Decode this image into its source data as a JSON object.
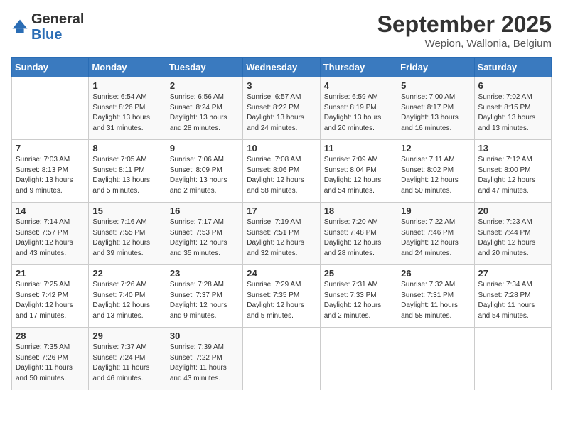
{
  "logo": {
    "general": "General",
    "blue": "Blue"
  },
  "title": "September 2025",
  "location": "Wepion, Wallonia, Belgium",
  "days_of_week": [
    "Sunday",
    "Monday",
    "Tuesday",
    "Wednesday",
    "Thursday",
    "Friday",
    "Saturday"
  ],
  "weeks": [
    [
      {
        "day": "",
        "info": ""
      },
      {
        "day": "1",
        "info": "Sunrise: 6:54 AM\nSunset: 8:26 PM\nDaylight: 13 hours\nand 31 minutes."
      },
      {
        "day": "2",
        "info": "Sunrise: 6:56 AM\nSunset: 8:24 PM\nDaylight: 13 hours\nand 28 minutes."
      },
      {
        "day": "3",
        "info": "Sunrise: 6:57 AM\nSunset: 8:22 PM\nDaylight: 13 hours\nand 24 minutes."
      },
      {
        "day": "4",
        "info": "Sunrise: 6:59 AM\nSunset: 8:19 PM\nDaylight: 13 hours\nand 20 minutes."
      },
      {
        "day": "5",
        "info": "Sunrise: 7:00 AM\nSunset: 8:17 PM\nDaylight: 13 hours\nand 16 minutes."
      },
      {
        "day": "6",
        "info": "Sunrise: 7:02 AM\nSunset: 8:15 PM\nDaylight: 13 hours\nand 13 minutes."
      }
    ],
    [
      {
        "day": "7",
        "info": "Sunrise: 7:03 AM\nSunset: 8:13 PM\nDaylight: 13 hours\nand 9 minutes."
      },
      {
        "day": "8",
        "info": "Sunrise: 7:05 AM\nSunset: 8:11 PM\nDaylight: 13 hours\nand 5 minutes."
      },
      {
        "day": "9",
        "info": "Sunrise: 7:06 AM\nSunset: 8:09 PM\nDaylight: 13 hours\nand 2 minutes."
      },
      {
        "day": "10",
        "info": "Sunrise: 7:08 AM\nSunset: 8:06 PM\nDaylight: 12 hours\nand 58 minutes."
      },
      {
        "day": "11",
        "info": "Sunrise: 7:09 AM\nSunset: 8:04 PM\nDaylight: 12 hours\nand 54 minutes."
      },
      {
        "day": "12",
        "info": "Sunrise: 7:11 AM\nSunset: 8:02 PM\nDaylight: 12 hours\nand 50 minutes."
      },
      {
        "day": "13",
        "info": "Sunrise: 7:12 AM\nSunset: 8:00 PM\nDaylight: 12 hours\nand 47 minutes."
      }
    ],
    [
      {
        "day": "14",
        "info": "Sunrise: 7:14 AM\nSunset: 7:57 PM\nDaylight: 12 hours\nand 43 minutes."
      },
      {
        "day": "15",
        "info": "Sunrise: 7:16 AM\nSunset: 7:55 PM\nDaylight: 12 hours\nand 39 minutes."
      },
      {
        "day": "16",
        "info": "Sunrise: 7:17 AM\nSunset: 7:53 PM\nDaylight: 12 hours\nand 35 minutes."
      },
      {
        "day": "17",
        "info": "Sunrise: 7:19 AM\nSunset: 7:51 PM\nDaylight: 12 hours\nand 32 minutes."
      },
      {
        "day": "18",
        "info": "Sunrise: 7:20 AM\nSunset: 7:48 PM\nDaylight: 12 hours\nand 28 minutes."
      },
      {
        "day": "19",
        "info": "Sunrise: 7:22 AM\nSunset: 7:46 PM\nDaylight: 12 hours\nand 24 minutes."
      },
      {
        "day": "20",
        "info": "Sunrise: 7:23 AM\nSunset: 7:44 PM\nDaylight: 12 hours\nand 20 minutes."
      }
    ],
    [
      {
        "day": "21",
        "info": "Sunrise: 7:25 AM\nSunset: 7:42 PM\nDaylight: 12 hours\nand 17 minutes."
      },
      {
        "day": "22",
        "info": "Sunrise: 7:26 AM\nSunset: 7:40 PM\nDaylight: 12 hours\nand 13 minutes."
      },
      {
        "day": "23",
        "info": "Sunrise: 7:28 AM\nSunset: 7:37 PM\nDaylight: 12 hours\nand 9 minutes."
      },
      {
        "day": "24",
        "info": "Sunrise: 7:29 AM\nSunset: 7:35 PM\nDaylight: 12 hours\nand 5 minutes."
      },
      {
        "day": "25",
        "info": "Sunrise: 7:31 AM\nSunset: 7:33 PM\nDaylight: 12 hours\nand 2 minutes."
      },
      {
        "day": "26",
        "info": "Sunrise: 7:32 AM\nSunset: 7:31 PM\nDaylight: 11 hours\nand 58 minutes."
      },
      {
        "day": "27",
        "info": "Sunrise: 7:34 AM\nSunset: 7:28 PM\nDaylight: 11 hours\nand 54 minutes."
      }
    ],
    [
      {
        "day": "28",
        "info": "Sunrise: 7:35 AM\nSunset: 7:26 PM\nDaylight: 11 hours\nand 50 minutes."
      },
      {
        "day": "29",
        "info": "Sunrise: 7:37 AM\nSunset: 7:24 PM\nDaylight: 11 hours\nand 46 minutes."
      },
      {
        "day": "30",
        "info": "Sunrise: 7:39 AM\nSunset: 7:22 PM\nDaylight: 11 hours\nand 43 minutes."
      },
      {
        "day": "",
        "info": ""
      },
      {
        "day": "",
        "info": ""
      },
      {
        "day": "",
        "info": ""
      },
      {
        "day": "",
        "info": ""
      }
    ]
  ]
}
